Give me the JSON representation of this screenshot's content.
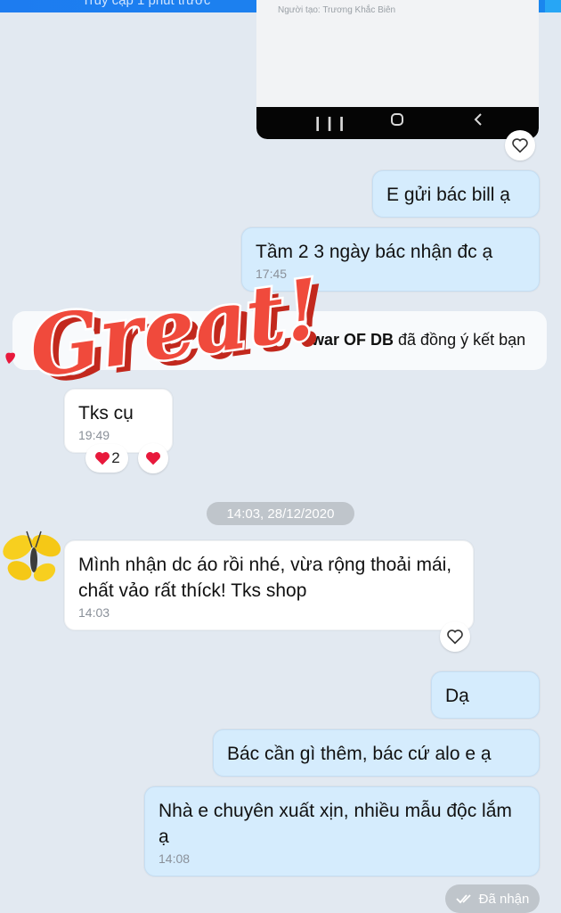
{
  "top_bar": {
    "status": "Truy cập 1 phút trước"
  },
  "screenshot_preview": {
    "caption": "Người tạo: Trương Khắc Biên"
  },
  "messages": [
    {
      "text": "E gửi bác bill ạ"
    },
    {
      "text": "Tầm 2 3 ngày bác nhận đc ạ",
      "time": "17:45"
    },
    {
      "text": "Tks cụ",
      "time": "19:49"
    },
    {
      "text": "Mình nhận dc áo rồi nhé, vừa rộng thoải mái, chất vảo rất thíck! Tks shop",
      "time": "14:03"
    },
    {
      "text": "Dạ"
    },
    {
      "text": "Bác cần gì thêm, bác cứ alo e ạ"
    },
    {
      "text": "Nhà e chuyên xuất xịn, nhiều mẫu độc lắm ạ",
      "time": "14:08"
    }
  ],
  "friend_notice": {
    "name": "war OF DB",
    "suffix": " đã đồng ý kết bạn"
  },
  "reactions": {
    "heart_count": "2"
  },
  "sticker": {
    "text": "Great!"
  },
  "date_separator": "14:03, 28/12/2020",
  "delivery_status": "Đã nhận",
  "colors": {
    "accent": "#1d7cf0",
    "sent_bubble": "#d5ecfd",
    "sticker_red": "#f04a3c",
    "heart": "#e8193c"
  }
}
